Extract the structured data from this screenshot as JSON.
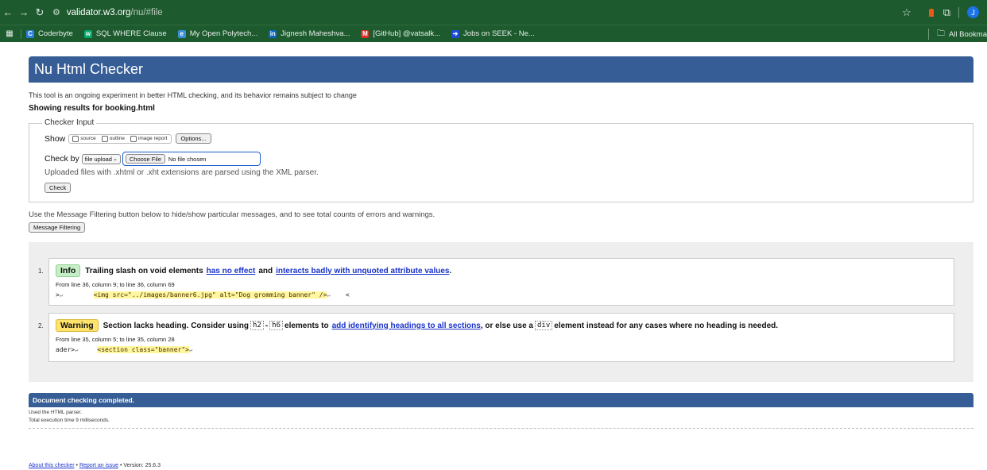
{
  "browser": {
    "url_host": "validator.w3.org",
    "url_path": "/nu/#file",
    "avatar_letter": "J",
    "bookmarks": [
      {
        "label": "Coderbyte",
        "icon": "coderbyte-icon",
        "color": "#2a7de1",
        "glyph": "C"
      },
      {
        "label": "SQL WHERE Clause",
        "icon": "w3schools-icon",
        "color": "#04aa6d",
        "glyph": "w"
      },
      {
        "label": "My Open Polytech...",
        "icon": "polytech-icon",
        "color": "#3a8fd8",
        "glyph": "e"
      },
      {
        "label": "Jignesh Maheshva...",
        "icon": "linkedin-icon",
        "color": "#0a66c2",
        "glyph": "in"
      },
      {
        "label": "[GitHub] @vatsalk...",
        "icon": "gmail-icon",
        "color": "#d93025",
        "glyph": "M"
      },
      {
        "label": "Jobs on SEEK - Ne...",
        "icon": "seek-icon",
        "color": "#1c4ad6",
        "glyph": "➔"
      }
    ],
    "all_bookmarks": "All Bookma"
  },
  "page": {
    "title": "Nu Html Checker",
    "intro": "This tool is an ongoing experiment in better HTML checking, and its behavior remains subject to change",
    "showing": "Showing results for booking.html",
    "checker_input": {
      "legend": "Checker Input",
      "show_label": "Show",
      "options": [
        "source",
        "outline",
        "image report"
      ],
      "options_button": "Options...",
      "check_by_label": "Check by",
      "check_by_value": "file upload",
      "choose_file": "Choose File",
      "no_file": "No file chosen",
      "note": "Uploaded files with .xhtml or .xht extensions are parsed using the XML parser.",
      "check_button": "Check"
    },
    "filter_text": "Use the Message Filtering button below to hide/show particular messages, and to see total counts of errors and warnings.",
    "filter_button": "Message Filtering",
    "messages": [
      {
        "num": "1.",
        "type": "Info",
        "text_a": "Trailing slash on void elements",
        "link1": "has no effect",
        "text_b": "and",
        "link2": "interacts badly with unquoted attribute values",
        "text_c": ".",
        "location": "From line 36, column 9; to line 36, column 69",
        "src_pre": ">",
        "src_hl": "<img src=\"../images/banner6.jpg\" alt=\"Dog gromming banner\" />",
        "src_post": "<"
      },
      {
        "num": "2.",
        "type": "Warning",
        "text_a": "Section lacks heading. Consider using",
        "code1": "h2",
        "dash": "-",
        "code2": "h6",
        "text_b": "elements to",
        "link1": "add identifying headings to all sections",
        "text_c": ", or else use a",
        "code3": "div",
        "text_d": "element instead for any cases where no heading is needed.",
        "location": "From line 35, column 5; to line 35, column 28",
        "src_pre": "ader>",
        "src_hl": "<section class=\"banner\">"
      }
    ],
    "complete": "Document checking completed.",
    "parser": "Used the HTML parser.",
    "exec_time": "Total execution time 9 milliseconds.",
    "footer": {
      "about": "About this checker",
      "dot": "•",
      "report": "Report an issue",
      "version": "• Version: 25.6.3"
    }
  }
}
